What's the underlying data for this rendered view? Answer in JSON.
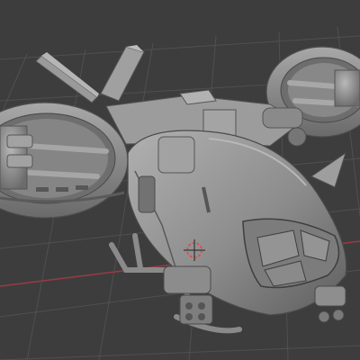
{
  "viewport": {
    "background_color": "#3d3d3d",
    "grid_color": "#505050",
    "x_axis_color": "#9a3a44",
    "mesh_color": "#8e8e8e",
    "mesh_shadow_color": "#5a5a5a",
    "mesh_highlight_color": "#b4b4b4",
    "origin_marker_color": "#e04848",
    "object": "vtol-aircraft-mesh",
    "parts": [
      "fuselage",
      "cockpit-canopy",
      "left-rotor-ring",
      "right-rotor-ring",
      "tail-fins",
      "antenna-mast",
      "landing-skids",
      "nose-gun-turret"
    ]
  }
}
